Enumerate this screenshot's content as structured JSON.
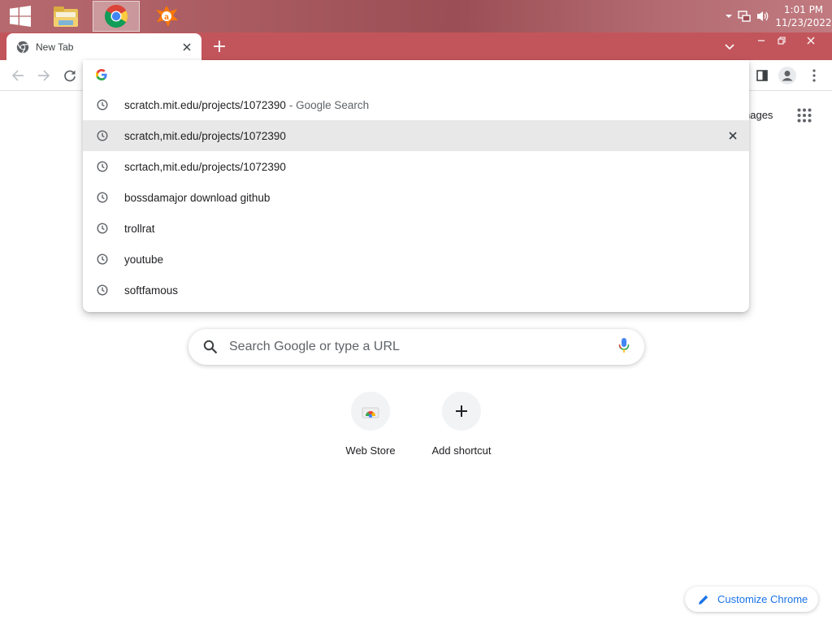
{
  "taskbar": {
    "start_icon": "windows-logo-icon",
    "apps": [
      "file-explorer-icon",
      "chrome-icon",
      "avast-icon"
    ],
    "tray_icons": [
      "show-hidden-icons-chevron",
      "network-icon",
      "volume-icon"
    ],
    "time": "1:01 PM",
    "date": "11/23/2022"
  },
  "browser": {
    "tab": {
      "title": "New Tab",
      "close_icon": "close-icon"
    },
    "new_tab_icon": "plus-icon",
    "omnibox": {
      "value": "",
      "icon": "google-g-icon"
    },
    "suggestions": [
      {
        "text": "scratch.mit.edu/projects/1072390",
        "desc": "- Google Search",
        "icon": "history-clock-icon"
      },
      {
        "text": "scratch,mit.edu/projects/1072390",
        "desc": "",
        "icon": "history-clock-icon",
        "selected": true
      },
      {
        "text": "scrtach,mit.edu/projects/1072390",
        "desc": "",
        "icon": "history-clock-icon"
      },
      {
        "text": "bossdamajor download github",
        "desc": "",
        "icon": "history-clock-icon"
      },
      {
        "text": "trollrat",
        "desc": "",
        "icon": "history-clock-icon"
      },
      {
        "text": "youtube",
        "desc": "",
        "icon": "history-clock-icon"
      },
      {
        "text": "softfamous",
        "desc": "",
        "icon": "history-clock-icon"
      }
    ]
  },
  "ntp": {
    "images_link": "nages",
    "search_placeholder": "Search Google or type a URL",
    "shortcuts": [
      {
        "label": "Web Store",
        "icon": "web-store-icon"
      },
      {
        "label": "Add shortcut",
        "icon": "plus-icon"
      }
    ],
    "customize_label": "Customize Chrome"
  },
  "colors": {
    "tabstrip": "#c2555b",
    "accent_blue": "#1a73e8",
    "selected_row": "#e8e8e8"
  }
}
